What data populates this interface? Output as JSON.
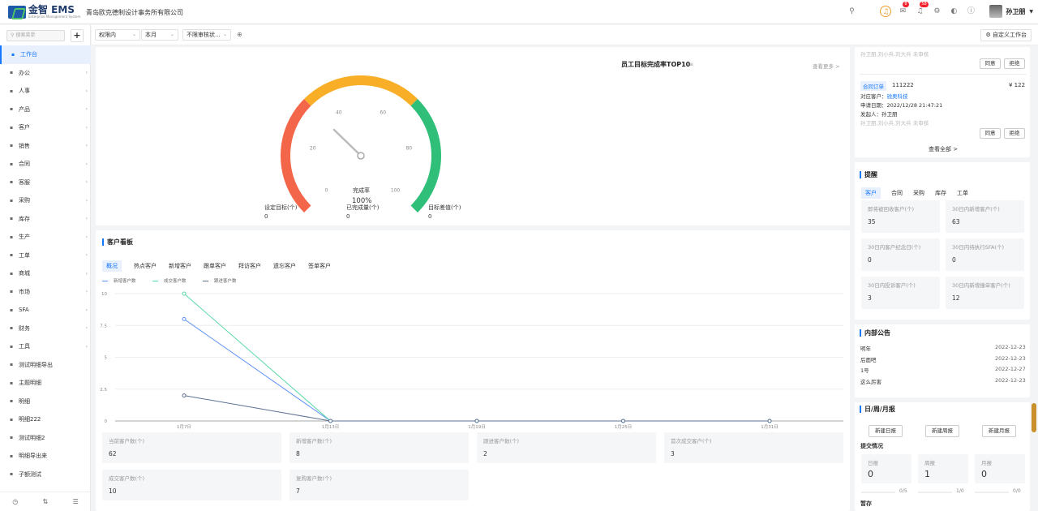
{
  "header": {
    "logo_text": "金智 EMS",
    "logo_sub": "Enterprise Management System",
    "company": "青岛欧克德制设计事务所有限公司",
    "badges": [
      "8",
      "58"
    ],
    "username": "孙卫朋"
  },
  "sidebar": {
    "search_placeholder": "搜索菜单",
    "items": [
      {
        "label": "工作台",
        "icon": "grid-icon"
      },
      {
        "label": "办公",
        "icon": "office-icon"
      },
      {
        "label": "人事",
        "icon": "user-icon"
      },
      {
        "label": "产品",
        "icon": "box-icon"
      },
      {
        "label": "客户",
        "icon": "customer-icon"
      },
      {
        "label": "销售",
        "icon": "sales-icon"
      },
      {
        "label": "合同",
        "icon": "contract-icon"
      },
      {
        "label": "客服",
        "icon": "service-icon"
      },
      {
        "label": "采购",
        "icon": "cart-icon"
      },
      {
        "label": "库存",
        "icon": "stock-icon"
      },
      {
        "label": "生产",
        "icon": "production-icon"
      },
      {
        "label": "工单",
        "icon": "ticket-icon"
      },
      {
        "label": "商城",
        "icon": "shop-icon"
      },
      {
        "label": "市场",
        "icon": "market-icon"
      },
      {
        "label": "SFA",
        "icon": "sfa-icon"
      },
      {
        "label": "财务",
        "icon": "finance-icon"
      },
      {
        "label": "工具",
        "icon": "tool-icon"
      },
      {
        "label": "测试明细导出",
        "icon": "list-icon"
      },
      {
        "label": "主题明细",
        "icon": "list-icon"
      },
      {
        "label": "明细",
        "icon": "list-icon"
      },
      {
        "label": "明细222",
        "icon": "list-icon"
      },
      {
        "label": "测试明细2",
        "icon": "list-icon"
      },
      {
        "label": "明细导出来",
        "icon": "list-icon"
      },
      {
        "label": "子额测试",
        "icon": "list-icon"
      }
    ]
  },
  "filters": {
    "scope": "权限内",
    "period": "本月",
    "audit": "不限审核状...",
    "custom_button": "自定义工作台"
  },
  "gauge": {
    "title": "员工目标完成率TOP10",
    "more": "查看更多 >",
    "ticks": [
      "0",
      "20",
      "40",
      "60",
      "80",
      "100"
    ],
    "center_label": "完成率",
    "center_value": "100%",
    "value": 0.33,
    "stats": [
      {
        "label": "设定目标(个)",
        "value": "0"
      },
      {
        "label": "已完成量(个)",
        "value": "0"
      },
      {
        "label": "目标差值(个)",
        "value": "0"
      }
    ]
  },
  "customer_board": {
    "title": "客户看板",
    "tabs": [
      "概况",
      "热点客户",
      "新增客户",
      "跟单客户",
      "拜访客户",
      "遗忘客户",
      "签单客户"
    ],
    "stats": [
      {
        "label": "当前客户数(个)",
        "value": "62"
      },
      {
        "label": "新增客户数(个)",
        "value": "8"
      },
      {
        "label": "跟进客户数(个)",
        "value": "2"
      },
      {
        "label": "首次成交客户(个)",
        "value": "3"
      },
      {
        "label": "成交客户数(个)",
        "value": "10"
      },
      {
        "label": "复购客户数(个)",
        "value": "7"
      }
    ]
  },
  "chart_data": {
    "type": "line",
    "x": [
      "1月7日",
      "1月13日",
      "1月19日",
      "1月25日",
      "1月31日"
    ],
    "ylim": [
      0,
      10
    ],
    "yticks": [
      "0",
      "2.5",
      "5",
      "7.5",
      "10"
    ],
    "series": [
      {
        "name": "新增客户数",
        "color": "#5b8ff9",
        "values": [
          8,
          0,
          0,
          0,
          0
        ]
      },
      {
        "name": "成交客户数",
        "color": "#5ad8a6",
        "values": [
          10,
          0,
          0,
          0,
          0
        ]
      },
      {
        "name": "跟进客户数",
        "color": "#5d7092",
        "values": [
          2,
          0,
          0,
          0,
          0
        ]
      }
    ]
  },
  "approval": {
    "top_note": "孙卫朋,刘小兵,刘大兵 未审核",
    "agree": "同意",
    "reject": "拒绝",
    "tag": "合同订单",
    "number": "111222",
    "amount": "¥ 122",
    "customer_label": "对应客户：",
    "customer": "锐奥科技",
    "date_label": "申请日期：",
    "date": "2022/12/28 21:47:21",
    "initiator_label": "发起人：",
    "initiator": "孙卫朋",
    "note": "孙卫朋,刘小兵,刘大兵 未审核",
    "view_all": "查看全部 >"
  },
  "reminder": {
    "title": "提醒",
    "tabs": [
      "客户",
      "合同",
      "采购",
      "库存",
      "工单"
    ],
    "stats": [
      {
        "label": "即将被回收客户(个)",
        "value": "35"
      },
      {
        "label": "30日内新增客户(个)",
        "value": "63"
      },
      {
        "label": "30日内客户纪念日(个)",
        "value": "0"
      },
      {
        "label": "30日内待执行SFA(个)",
        "value": "0"
      },
      {
        "label": "30日内投诉客户(个)",
        "value": "3"
      },
      {
        "label": "30日内新增撞单客户(个)",
        "value": "12"
      }
    ]
  },
  "notice": {
    "title": "内部公告",
    "items": [
      {
        "title": "明年",
        "date": "2022-12-23"
      },
      {
        "title": "后面吧",
        "date": "2022-12-23"
      },
      {
        "title": "1号",
        "date": "2022-12-27"
      },
      {
        "title": "这么厉害",
        "date": "2022-12-23"
      }
    ]
  },
  "report": {
    "title": "日/周/月报",
    "buttons": [
      "新建日报",
      "新建周报",
      "新建月报"
    ],
    "submit_title": "提交情况",
    "items": [
      {
        "label": "日报",
        "value": "0",
        "ratio": "0/5"
      },
      {
        "label": "周报",
        "value": "1",
        "ratio": "1/0"
      },
      {
        "label": "月报",
        "value": "0",
        "ratio": "0/0"
      }
    ],
    "draft": "暂存"
  }
}
